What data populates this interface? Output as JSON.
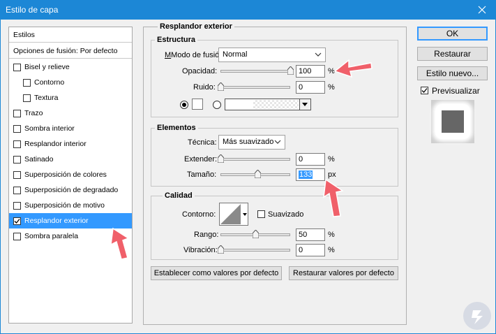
{
  "window": {
    "title": "Estilo de capa"
  },
  "styles_panel": {
    "header": "Estilos",
    "blend_options": "Opciones de fusión: Por defecto",
    "items": [
      {
        "label": "Bisel y relieve",
        "checked": false,
        "indent": false,
        "selected": false
      },
      {
        "label": "Contorno",
        "checked": false,
        "indent": true,
        "selected": false
      },
      {
        "label": "Textura",
        "checked": false,
        "indent": true,
        "selected": false
      },
      {
        "label": "Trazo",
        "checked": false,
        "indent": false,
        "selected": false
      },
      {
        "label": "Sombra interior",
        "checked": false,
        "indent": false,
        "selected": false
      },
      {
        "label": "Resplandor interior",
        "checked": false,
        "indent": false,
        "selected": false
      },
      {
        "label": "Satinado",
        "checked": false,
        "indent": false,
        "selected": false
      },
      {
        "label": "Superposición de colores",
        "checked": false,
        "indent": false,
        "selected": false
      },
      {
        "label": "Superposición de degradado",
        "checked": false,
        "indent": false,
        "selected": false
      },
      {
        "label": "Superposición de motivo",
        "checked": false,
        "indent": false,
        "selected": false
      },
      {
        "label": "Resplandor exterior",
        "checked": true,
        "indent": false,
        "selected": true
      },
      {
        "label": "Sombra paralela",
        "checked": false,
        "indent": false,
        "selected": false
      }
    ]
  },
  "outer_glow": {
    "title": "Resplandor exterior",
    "structure": {
      "title": "Estructura",
      "blend_mode_label": "Modo de fusión:",
      "blend_mode_value": "Normal",
      "opacity_label": "Opacidad:",
      "opacity_value": "100",
      "opacity_unit": "%",
      "opacity_level": 1.0,
      "noise_label": "Ruido:",
      "noise_value": "0",
      "noise_unit": "%",
      "noise_level": 0.0
    },
    "elements": {
      "title": "Elementos",
      "technique_label": "Técnica:",
      "technique_value": "Más suavizado",
      "spread_label": "Extender:",
      "spread_value": "0",
      "spread_unit": "%",
      "spread_level": 0.0,
      "size_label": "Tamaño:",
      "size_value": "133",
      "size_unit": "px",
      "size_level": 0.53
    },
    "quality": {
      "title": "Calidad",
      "contour_label": "Contorno:",
      "antialias_label": "Suavizado",
      "range_label": "Rango:",
      "range_value": "50",
      "range_unit": "%",
      "range_level": 0.5,
      "jitter_label": "Vibración:",
      "jitter_value": "0",
      "jitter_unit": "%",
      "jitter_level": 0.0
    },
    "set_default_button": "Establecer como valores por defecto",
    "reset_default_button": "Restaurar valores por defecto"
  },
  "side_buttons": {
    "ok": "OK",
    "reset": "Restaurar",
    "new_style": "Estilo nuevo...",
    "preview_label": "Previsualizar",
    "preview_checked": true
  },
  "colors": {
    "accent": "#3399ff",
    "titlebar": "#1c87d6",
    "annotation_arrow": "#f0606a"
  }
}
